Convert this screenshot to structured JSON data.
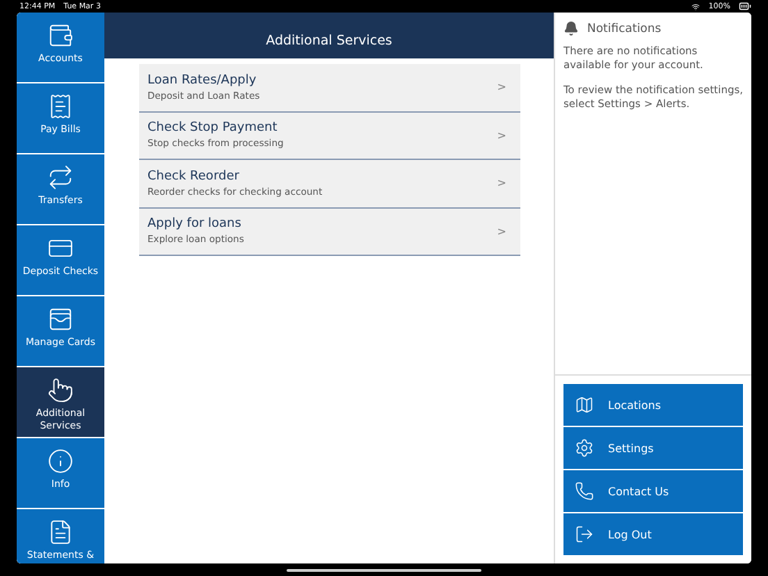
{
  "status_bar": {
    "time": "12:44 PM",
    "date": "Tue Mar 3",
    "battery": "100%"
  },
  "sidebar": {
    "items": [
      {
        "label": "Accounts",
        "selected": false
      },
      {
        "label": "Pay Bills",
        "selected": false
      },
      {
        "label": "Transfers",
        "selected": false
      },
      {
        "label": "Deposit Checks",
        "selected": false
      },
      {
        "label": "Manage Cards",
        "selected": false
      },
      {
        "label": "Additional Services",
        "selected": true
      },
      {
        "label": "Info",
        "selected": false
      },
      {
        "label": "Statements &",
        "selected": false
      }
    ]
  },
  "main": {
    "title": "Additional Services",
    "items": [
      {
        "title": "Loan Rates/Apply",
        "subtitle": "Deposit and Loan Rates",
        "chevron": ">"
      },
      {
        "title": "Check Stop Payment",
        "subtitle": "Stop checks from processing",
        "chevron": ">"
      },
      {
        "title": "Check Reorder",
        "subtitle": "Reorder checks for checking account",
        "chevron": ">"
      },
      {
        "title": "Apply for loans",
        "subtitle": "Explore loan options",
        "chevron": ">"
      }
    ]
  },
  "notifications": {
    "title": "Notifications",
    "messages": [
      "There are no notifications available for your account.",
      "To review the notification settings, select Settings > Alerts."
    ]
  },
  "actions": [
    {
      "label": "Locations"
    },
    {
      "label": "Settings"
    },
    {
      "label": "Contact Us"
    },
    {
      "label": "Log Out"
    }
  ]
}
